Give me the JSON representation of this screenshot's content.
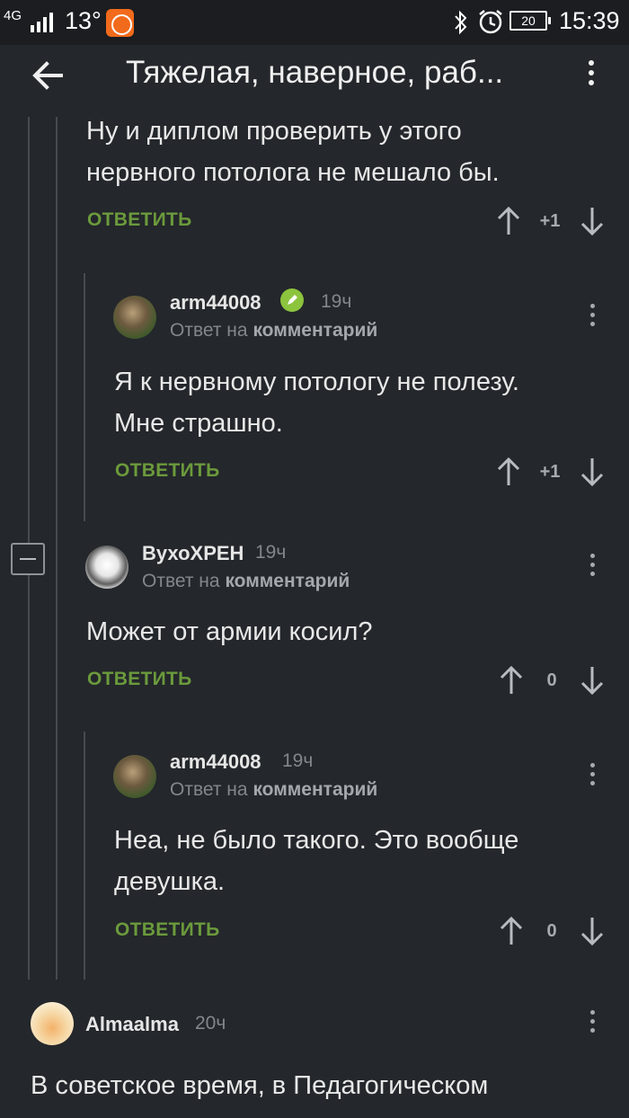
{
  "status_bar": {
    "network": "4G",
    "temperature": "13°",
    "battery": "20",
    "time": "15:39"
  },
  "toolbar": {
    "title": "Тяжелая, наверное, раб..."
  },
  "comments": [
    {
      "text_lines": [
        "Ну и диплом проверить у этого",
        "нервного потолога не мешало бы."
      ],
      "reply_label": "ОТВЕТИТЬ",
      "score": "+1"
    },
    {
      "username": "arm44008",
      "time": "19ч",
      "reply_to_prefix": "Ответ на",
      "reply_to_link": "комментарий",
      "text_lines": [
        "Я к нервному потологу не полезу.",
        "Мне страшно."
      ],
      "reply_label": "ОТВЕТИТЬ",
      "score": "+1"
    },
    {
      "username": "ВухоХРЕН",
      "time": "19ч",
      "reply_to_prefix": "Ответ на",
      "reply_to_link": "комментарий",
      "text_lines": [
        "Может от армии косил?"
      ],
      "reply_label": "ОТВЕТИТЬ",
      "score": "0"
    },
    {
      "username": "arm44008",
      "time": "19ч",
      "reply_to_prefix": "Ответ на",
      "reply_to_link": "комментарий",
      "text_lines": [
        "Неа, не было такого. Это вообще",
        "девушка."
      ],
      "reply_label": "ОТВЕТИТЬ",
      "score": "0"
    },
    {
      "username": "Almaalma",
      "time": "20ч",
      "text_lines": [
        "В советское время, в Педагогическом"
      ]
    }
  ],
  "colors": {
    "background": "#24272b",
    "accent_green": "#6b9a3c",
    "mi_orange": "#f26a1b"
  }
}
